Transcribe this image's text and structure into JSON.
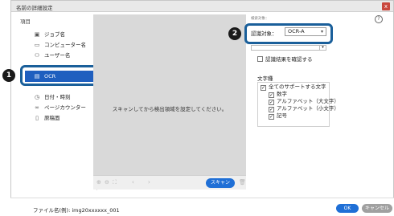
{
  "window": {
    "title": "名前の詳細設定",
    "close_label": "x"
  },
  "sidebar": {
    "header": "項目",
    "items": [
      {
        "icon": "calendar-icon",
        "glyph": "▣",
        "label": "ジョブ名"
      },
      {
        "icon": "computer-icon",
        "glyph": "▭",
        "label": "コンピューター名"
      },
      {
        "icon": "user-icon",
        "glyph": "⚇",
        "label": "ユーザー名"
      },
      {
        "icon": "ocr-icon",
        "glyph": "▤",
        "label": "OCR"
      },
      {
        "icon": "clock-icon",
        "glyph": "◷",
        "label": "日付・時刻"
      },
      {
        "icon": "page-counter-icon",
        "glyph": "∞",
        "label": "ページカウンター"
      },
      {
        "icon": "document-icon",
        "glyph": "▯",
        "label": "原稿面"
      }
    ]
  },
  "preview": {
    "message": "スキャンしてから検出領域を設定してください。",
    "scan_label": "スキャン"
  },
  "ocr_settings": {
    "small_label": "検索対象：",
    "target_label": "認識対象：",
    "target_value": "OCR-A",
    "confirm_label": "認識結果を確認する",
    "group_label": "文字種",
    "all_label": "全てのサポートする文字",
    "options": [
      "数字",
      "アルファベット（大文字）",
      "アルファベット（小文字）",
      "記号"
    ]
  },
  "callouts": {
    "badge1": "1",
    "badge2": "2"
  },
  "help": {
    "glyph": "?"
  },
  "footer": {
    "filename_label": "ファイル名(例):",
    "filename_value": "img20xxxxxx_001",
    "ok_label": "OK",
    "cancel_label": "キャンセル"
  }
}
